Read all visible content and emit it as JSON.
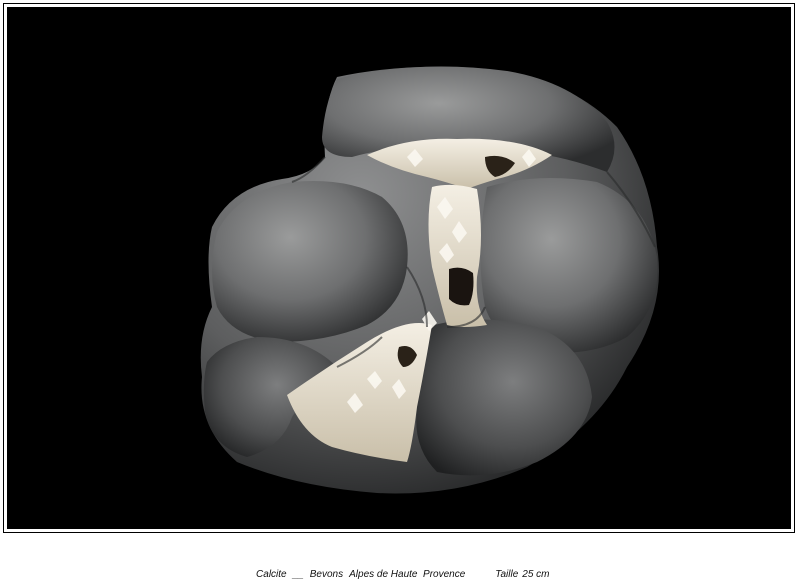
{
  "caption": {
    "mineral": "Calcite",
    "separator": "__",
    "locality": "Bevons",
    "region": "Alpes de Haute  Provence",
    "size_label": "Taille",
    "size_value": "25 cm"
  },
  "colors": {
    "background": "#000000",
    "frame": "#ffffff",
    "rock": "#6f7070",
    "crystal": "#e9e2d2"
  }
}
